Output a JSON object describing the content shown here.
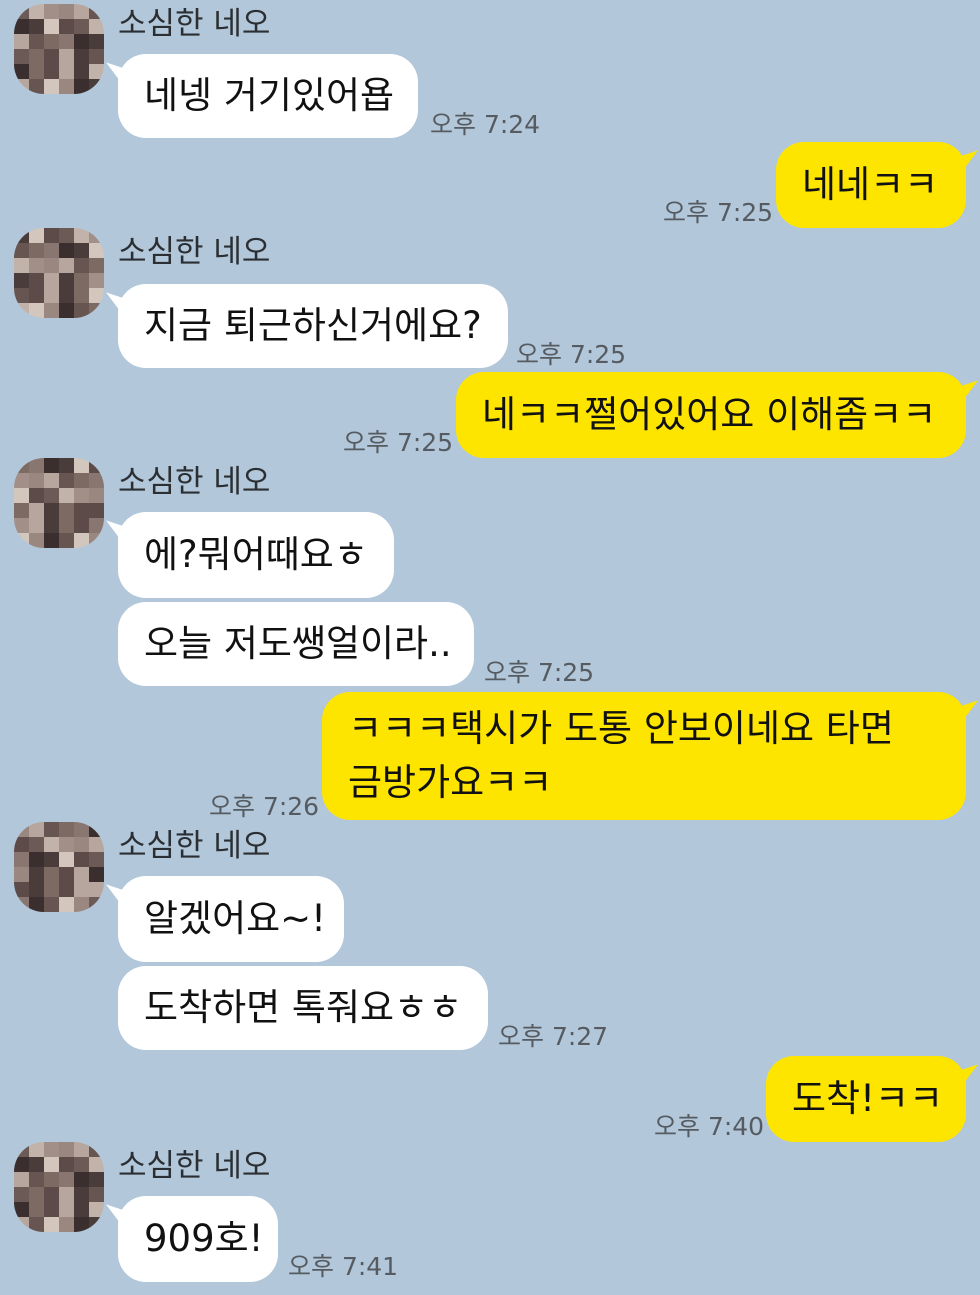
{
  "contact": {
    "name": "소심한 네오"
  },
  "colors": {
    "background": "#b2c7d9",
    "incoming": "#ffffff",
    "outgoing": "#fee500"
  },
  "messages": [
    {
      "text": "네넹 거기있어욥",
      "time": "오후 7:24"
    },
    {
      "text": "네네ㅋㅋ",
      "time": "오후 7:25"
    },
    {
      "text": "지금 퇴근하신거에요?",
      "time": "오후 7:25"
    },
    {
      "text": "네ㅋㅋ쩔어있어요 이해좀ㅋㅋ",
      "time": "오후 7:25"
    },
    {
      "text": "에?뭐어때요ㅎ"
    },
    {
      "text": "오늘 저도쌩얼이라..",
      "time": "오후 7:25"
    },
    {
      "line1": "ㅋㅋㅋ택시가 도통 안보이네요 타면",
      "line2": "금방가요ㅋㅋ",
      "time": "오후 7:26"
    },
    {
      "text": "알겠어요~!"
    },
    {
      "text": "도착하면 톡줘요ㅎㅎ",
      "time": "오후 7:27"
    },
    {
      "text": "도착!ㅋㅋ",
      "time": "오후 7:40"
    },
    {
      "text": "909호!",
      "time": "오후 7:41"
    }
  ]
}
